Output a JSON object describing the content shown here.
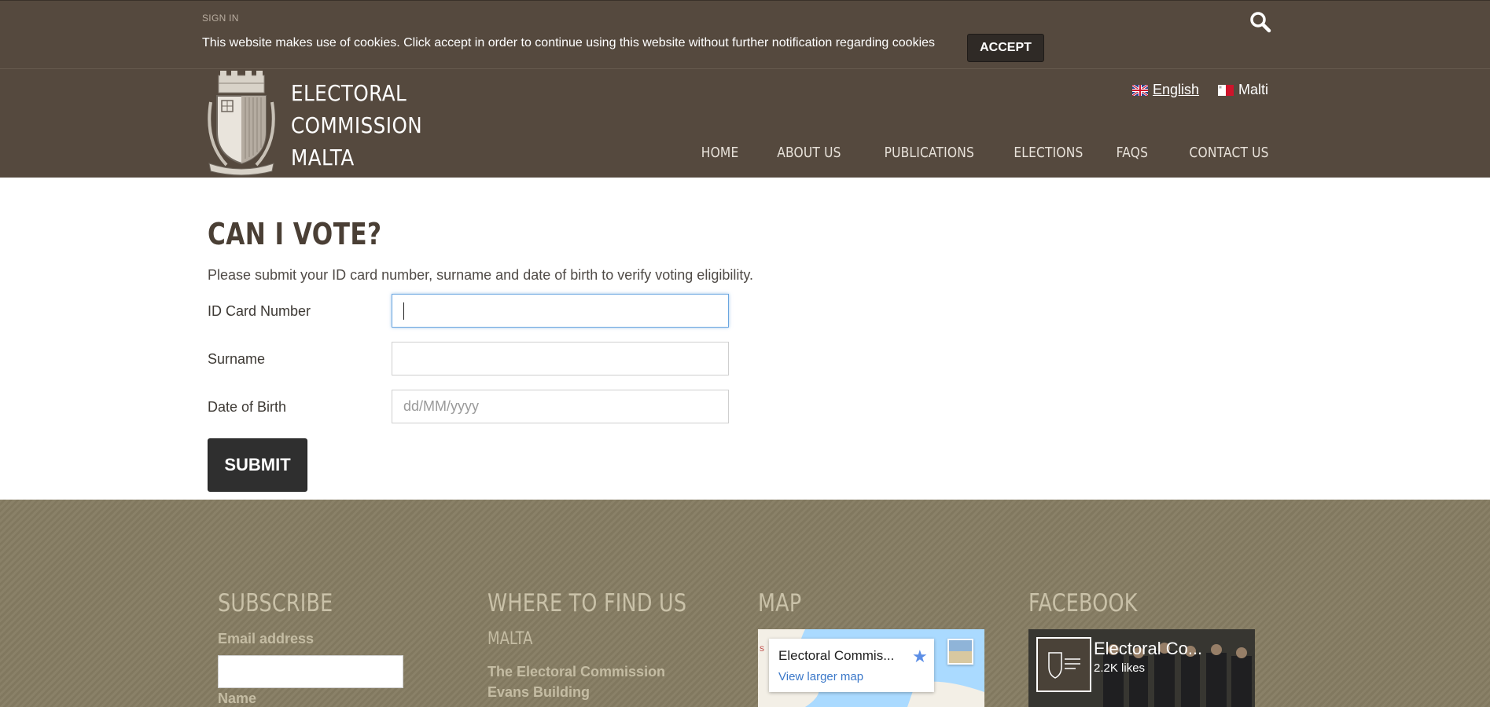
{
  "topbar": {
    "sign_in": "SIGN IN",
    "cookie_message": "This website makes use of cookies. Click accept in order to continue using this website without further notification regarding cookies",
    "accept_label": "ACCEPT",
    "search_icon": "search-icon"
  },
  "header": {
    "logo_lines": [
      "ELECTORAL",
      "COMMISSION",
      "MALTA"
    ],
    "languages": [
      {
        "label": "English",
        "flag": "uk-flag-icon",
        "active": true
      },
      {
        "label": "Malti",
        "flag": "malta-flag-icon",
        "active": false
      }
    ],
    "nav": [
      "HOME",
      "ABOUT US",
      "PUBLICATIONS",
      "ELECTIONS",
      "FAQS",
      "CONTACT US"
    ],
    "bg_color": "#55493e"
  },
  "main": {
    "title": "CAN I VOTE?",
    "description": "Please submit your ID card number, surname and date of birth to verify voting eligibility.",
    "fields": [
      {
        "label": "ID Card Number",
        "value": "",
        "placeholder": ""
      },
      {
        "label": "Surname",
        "value": "",
        "placeholder": ""
      },
      {
        "label": "Date of Birth",
        "value": "",
        "placeholder": "dd/MM/yyyy"
      }
    ],
    "submit_label": "SUBMIT"
  },
  "footer": {
    "bg_color": "#857c62",
    "subscribe": {
      "heading": "SUBSCRIBE",
      "email_label": "Email address",
      "name_label": "Name"
    },
    "where": {
      "heading": "WHERE TO FIND US",
      "country": "MALTA",
      "address_lines": [
        "The Electoral Commission",
        "Evans Building"
      ]
    },
    "map": {
      "heading": "MAP",
      "place_title": "Electoral Commis...",
      "link": "View larger map"
    },
    "facebook": {
      "heading": "FACEBOOK",
      "page_name": "Electoral Co...",
      "likes": "2.2K likes"
    }
  }
}
